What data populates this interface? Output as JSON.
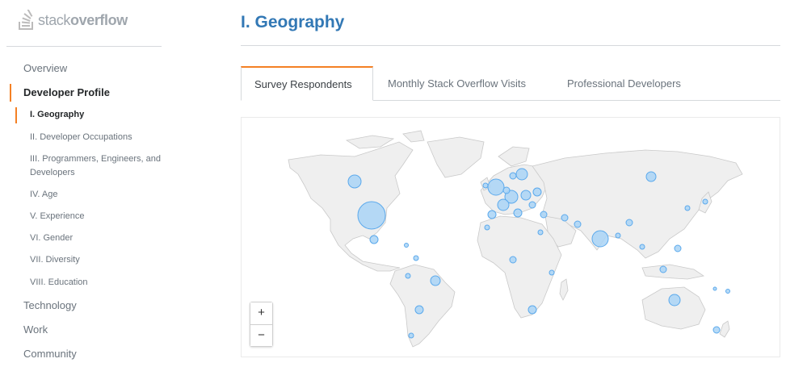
{
  "brand": {
    "prefix": "stack",
    "suffix": "overflow"
  },
  "sidebar": {
    "items": [
      {
        "label": "Overview"
      },
      {
        "label": "Developer Profile"
      },
      {
        "label": "Technology"
      },
      {
        "label": "Work"
      },
      {
        "label": "Community"
      }
    ],
    "subitems": [
      {
        "label": "I. Geography"
      },
      {
        "label": "II. Developer Occupations"
      },
      {
        "label": "III. Programmers, Engineers, and Developers"
      },
      {
        "label": "IV. Age"
      },
      {
        "label": "V. Experience"
      },
      {
        "label": "VI. Gender"
      },
      {
        "label": "VII. Diversity"
      },
      {
        "label": "VIII. Education"
      }
    ]
  },
  "main": {
    "title": "I. Geography",
    "tabs": [
      {
        "label": "Survey Respondents"
      },
      {
        "label": "Monthly Stack Overflow Visits"
      },
      {
        "label": "Professional Developers"
      }
    ]
  },
  "map": {
    "zoom_in": "+",
    "zoom_out": "−",
    "land_color": "#efefef",
    "bubble_color": "#a9d3f6",
    "bubble_border": "#5ba9ec"
  },
  "colors": {
    "accent": "#f48024",
    "title": "#3278b5"
  }
}
